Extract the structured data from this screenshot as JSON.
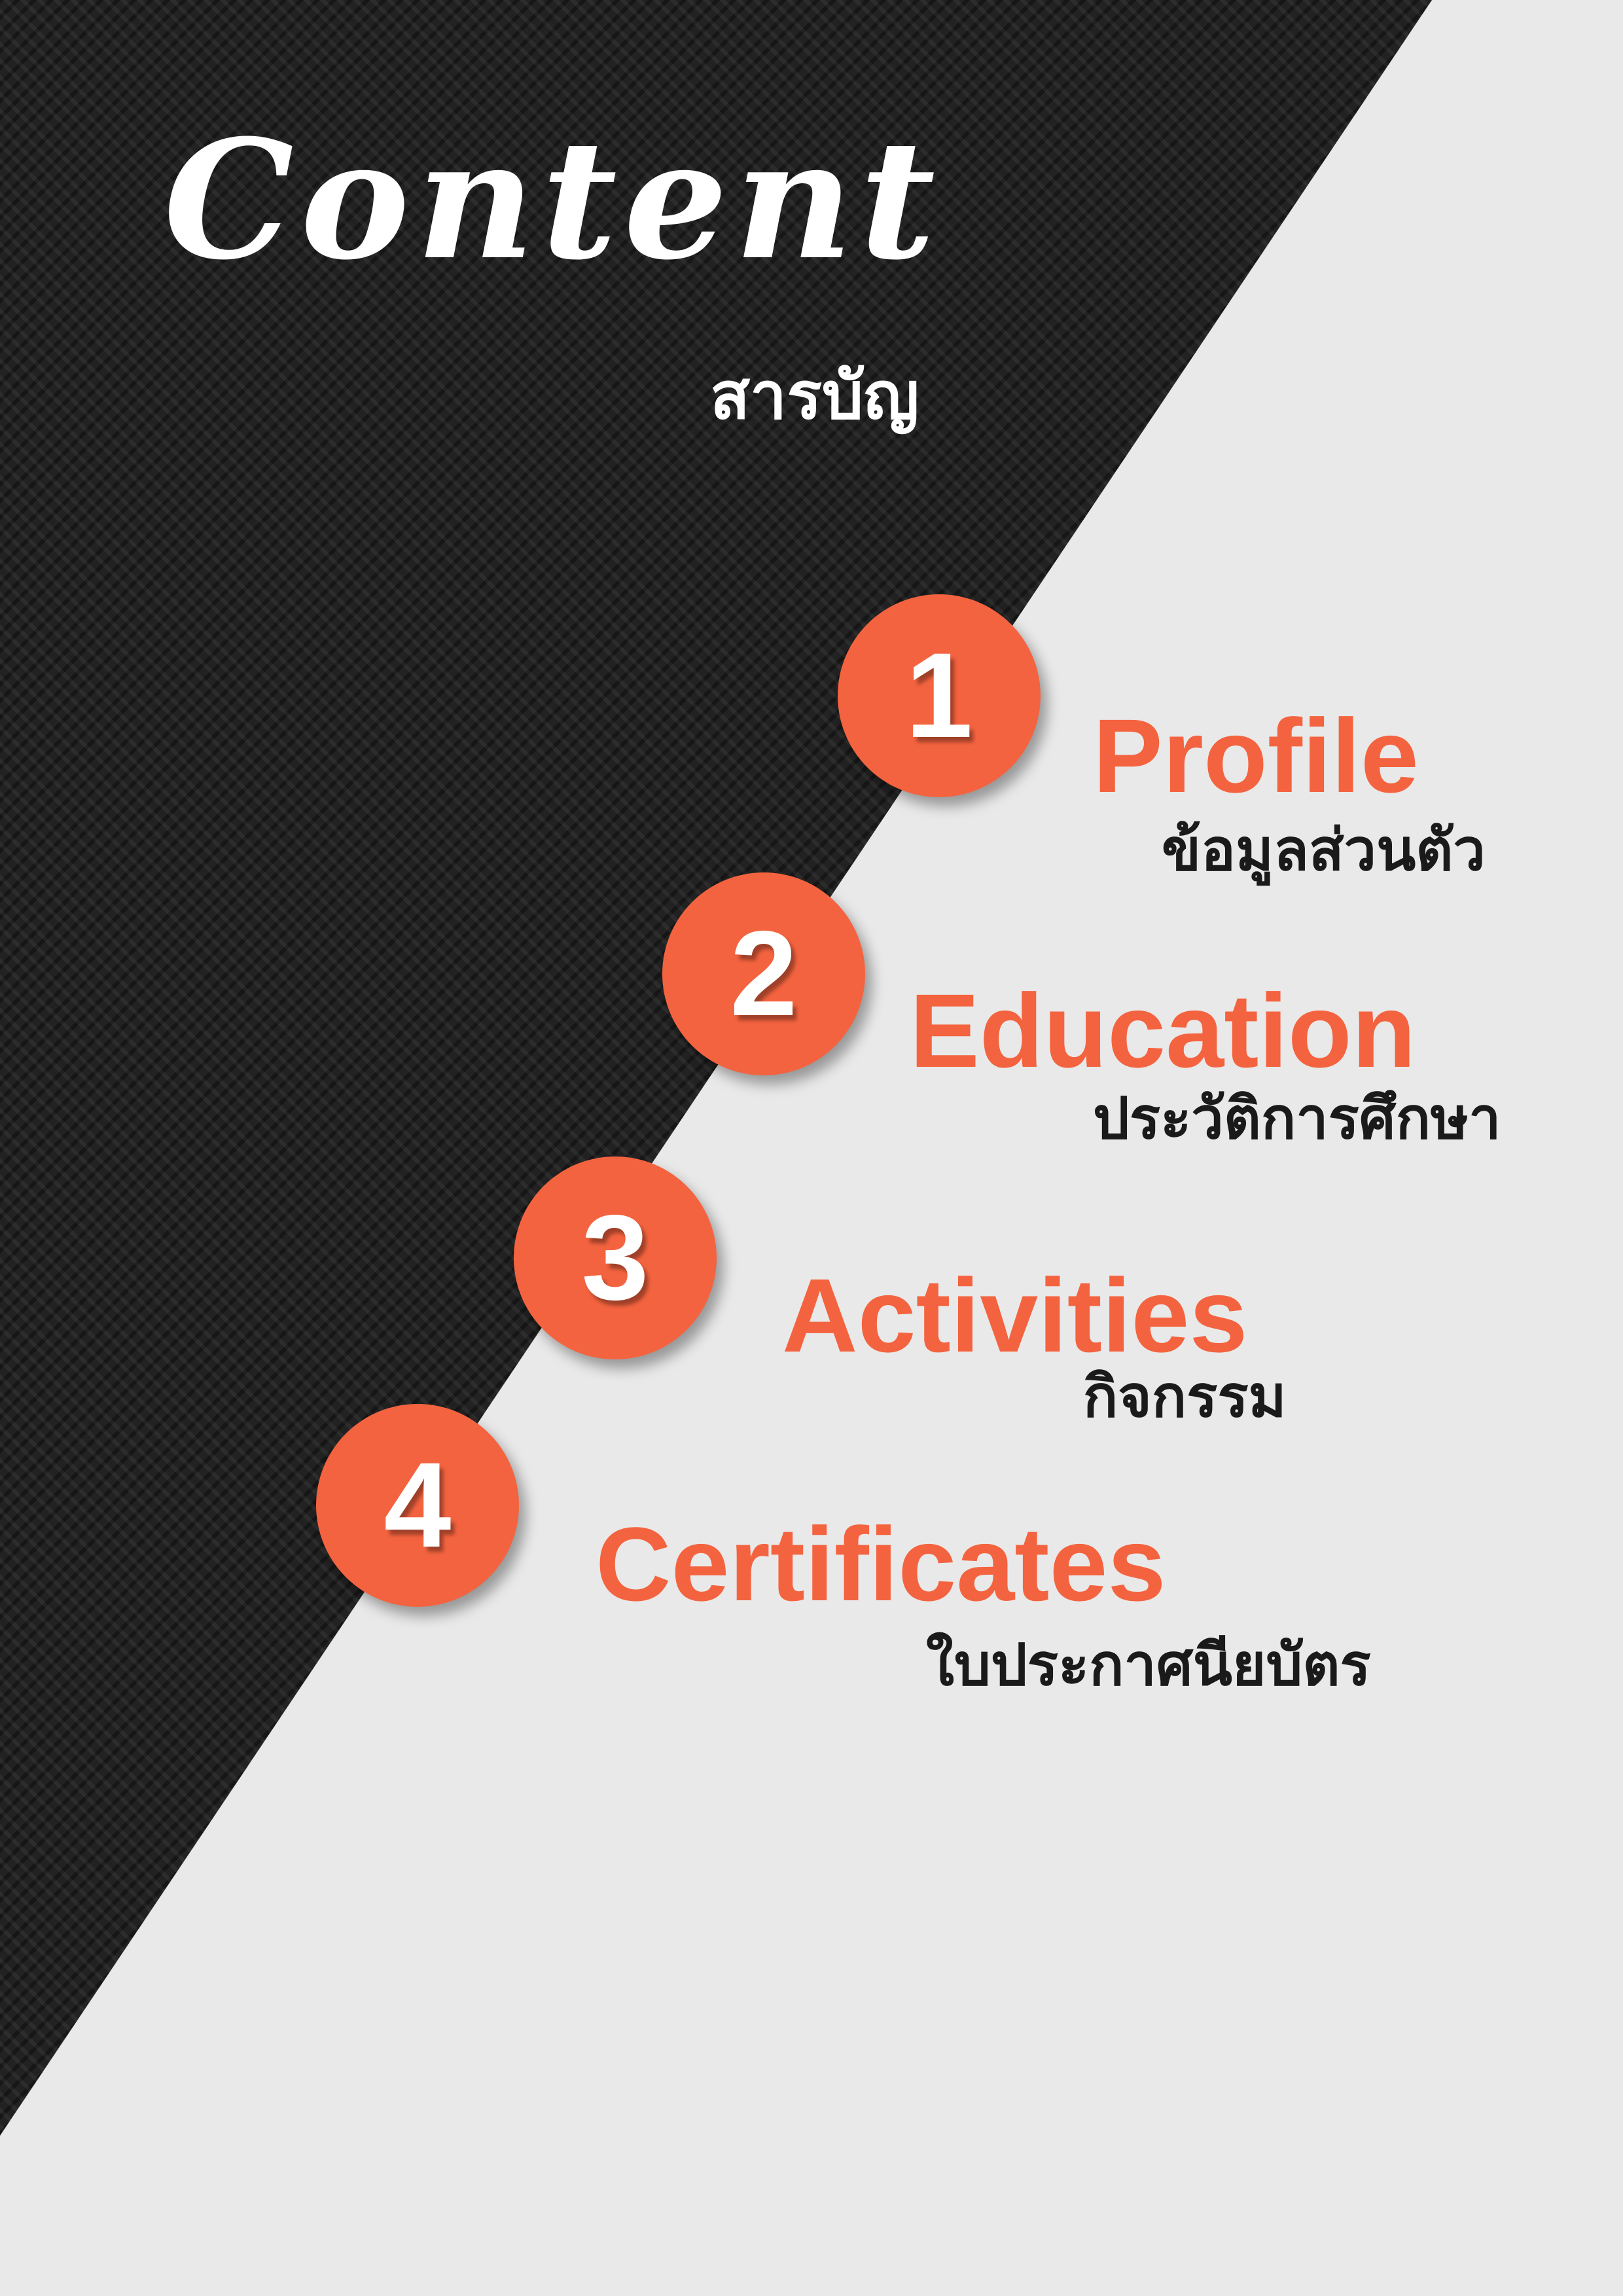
{
  "page": {
    "title": "Content",
    "subtitle": "สารบัญ"
  },
  "colors": {
    "accent": "#f4633f",
    "dark_panel": "#222222",
    "light_panel": "#e9e9e9"
  },
  "items": [
    {
      "number": "1",
      "label": "Profile",
      "sublabel": "ข้อมูลส่วนตัว"
    },
    {
      "number": "2",
      "label": "Education",
      "sublabel": "ประวัติการศึกษา"
    },
    {
      "number": "3",
      "label": "Activities",
      "sublabel": "กิจกรรม"
    },
    {
      "number": "4",
      "label": "Certificates",
      "sublabel": "ใบประกาศนียบัตร"
    }
  ]
}
